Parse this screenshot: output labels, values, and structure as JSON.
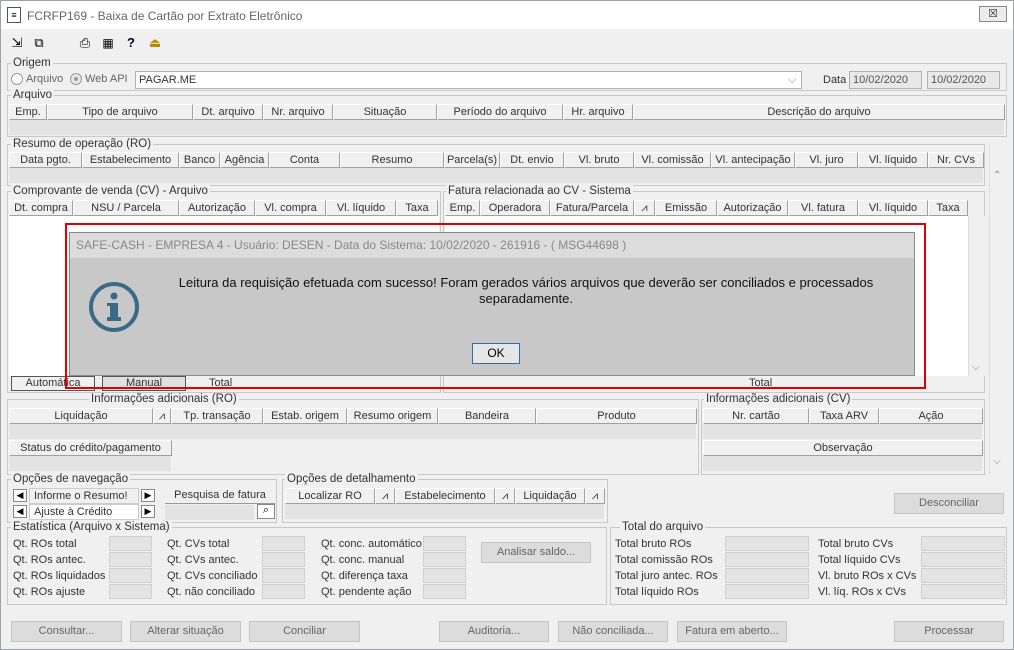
{
  "window": {
    "title": "FCRFP169 - Baixa de Cartão por Extrato Eletrônico",
    "close": "☒"
  },
  "toolbar": [
    {
      "icon": "arrow-icon",
      "glyph": "⇲"
    },
    {
      "icon": "restore-icon",
      "glyph": "⧉"
    },
    {
      "icon": "print-icon",
      "glyph": "🖶"
    },
    {
      "icon": "calculator-icon",
      "glyph": "▦"
    },
    {
      "icon": "help-icon",
      "glyph": "?"
    },
    {
      "icon": "exit-icon",
      "glyph": "⏏"
    }
  ],
  "origem": {
    "label": "Origem",
    "opt1": "Arquivo",
    "opt2": "Web API",
    "value": "PAGAR.ME",
    "data_label": "Data",
    "date1": "10/02/2020",
    "date2": "10/02/2020"
  },
  "arquivo": {
    "label": "Arquivo",
    "cols": [
      "Emp.",
      "Tipo de arquivo",
      "Dt. arquivo",
      "Nr. arquivo",
      "Situação",
      "Período do arquivo",
      "Hr. arquivo",
      "Descrição do arquivo"
    ]
  },
  "ro": {
    "label": "Resumo de operação (RO)",
    "cols": [
      "Data pgto.",
      "Estabelecimento",
      "Banco",
      "Agência",
      "Conta",
      "Resumo",
      "Parcela(s)",
      "Dt. envio",
      "Vl. bruto",
      "Vl. comissão",
      "Vl. antecipação",
      "Vl. juro",
      "Vl. líquido",
      "Nr. CVs"
    ]
  },
  "cv": {
    "label": "Comprovante de venda (CV) - Arquivo",
    "cols": [
      "Dt. compra",
      "NSU / Parcela",
      "Autorização",
      "Vl. compra",
      "Vl. líquido",
      "Taxa"
    ],
    "tab1": "Automática",
    "tab2": "Manual",
    "total": "Total"
  },
  "fatura": {
    "label": "Fatura relacionada ao CV - Sistema",
    "cols": [
      "Emp.",
      "Operadora",
      "Fatura/Parcela",
      "⩘",
      "Emissão",
      "Autorização",
      "Vl. fatura",
      "Vl. líquido",
      "Taxa"
    ],
    "total": "Total"
  },
  "info_ro": {
    "label": "Informações adicionais (RO)",
    "cols": [
      "Liquidação",
      "⩘",
      "Tp. transação",
      "Estab. origem",
      "Resumo origem",
      "Bandeira",
      "Produto"
    ],
    "status": "Status do crédito/pagamento"
  },
  "info_cv": {
    "label": "Informações adicionais (CV)",
    "cols": [
      "Nr. cartão",
      "Taxa ARV",
      "Ação"
    ],
    "obs": "Observação"
  },
  "nav": {
    "label": "Opções de navegação",
    "item1": "Informe o Resumo!",
    "item2": "Ajuste à Crédito",
    "search": "Pesquisa de fatura"
  },
  "det": {
    "label": "Opções de detalhamento",
    "cols": [
      "Localizar RO",
      "⩘",
      "Estabelecimento",
      "⩘",
      "Liquidação",
      "⩘"
    ]
  },
  "desconciliar": "Desconciliar",
  "estat": {
    "label": "Estatística (Arquivo x Sistema)",
    "c1": [
      "Qt. ROs total",
      "Qt. ROs antec.",
      "Qt. ROs liquidados",
      "Qt. ROs ajuste"
    ],
    "c2": [
      "Qt. CVs total",
      "Qt. CVs antec.",
      "Qt. CVs conciliado",
      "Qt. não conciliado"
    ],
    "c3": [
      "Qt. conc. automático",
      "Qt. conc. manual",
      "Qt. diferença taxa",
      "Qt. pendente ação"
    ],
    "analisar": "Analisar saldo..."
  },
  "total_arq": {
    "label": "Total do arquivo",
    "c1": [
      "Total bruto ROs",
      "Total comissão ROs",
      "Total juro antec. ROs",
      "Total líquido ROs"
    ],
    "c2": [
      "Total bruto CVs",
      "Total líquido CVs",
      "Vl. bruto ROs x CVs",
      "Vl. líq. ROs x CVs"
    ]
  },
  "buttons": {
    "consultar": "Consultar...",
    "alterar": "Alterar situação",
    "conciliar": "Conciliar",
    "auditoria": "Auditoria...",
    "nao_conc": "Não conciliada...",
    "fatura": "Fatura em aberto...",
    "processar": "Processar"
  },
  "dialog": {
    "title": "SAFE-CASH - EMPRESA 4 - Usuário: DESEN - Data do Sistema: 10/02/2020 - 261916 - ( MSG44698 )",
    "message": "Leitura da requisição efetuada com sucesso! Foram gerados vários arquivos que deverão ser conciliados e processados separadamente.",
    "ok": "OK",
    "icon": "info-icon"
  }
}
